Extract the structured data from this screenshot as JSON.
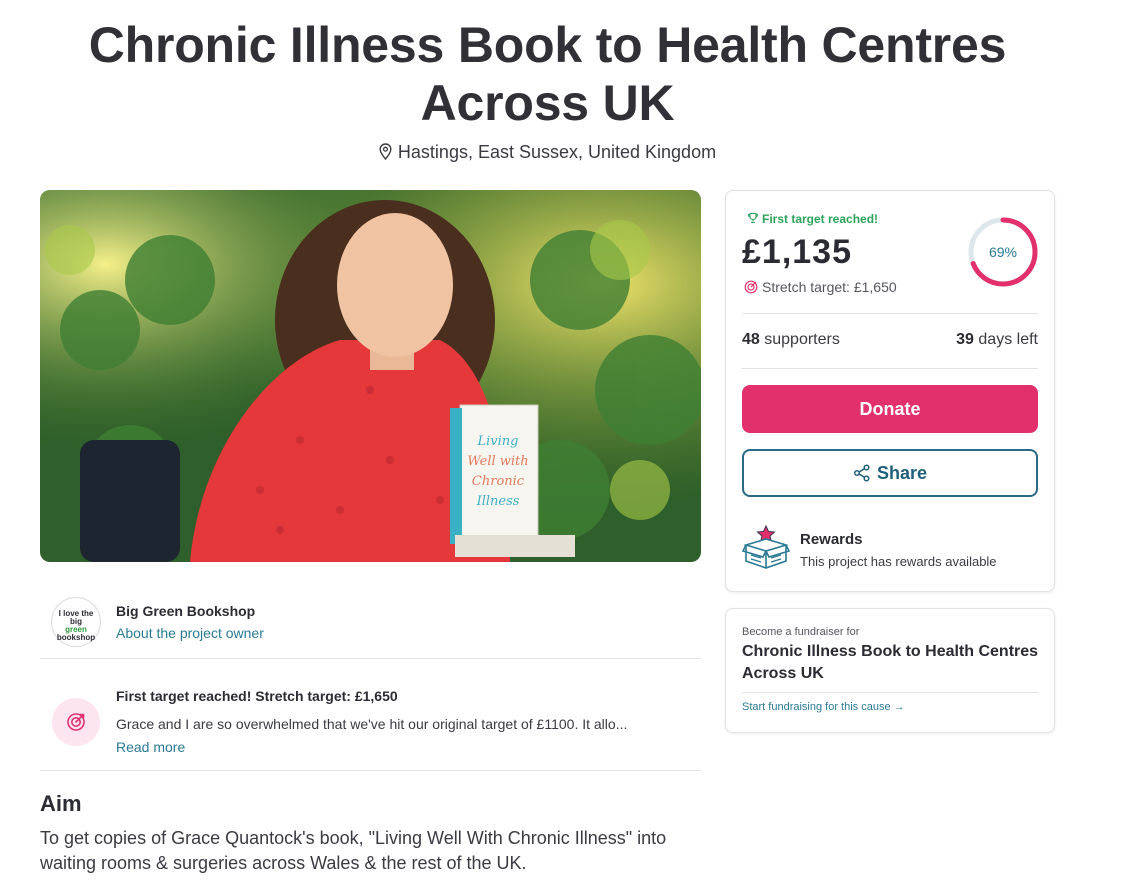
{
  "project": {
    "title": "Chronic Illness Book to Health Centres Across UK",
    "location": "Hastings, East Sussex, United Kingdom",
    "hero_image_alt": "photo"
  },
  "owner": {
    "name": "Big Green Bookshop",
    "link": "About the project owner",
    "logo_text_top": "I love the",
    "logo_text_mid": "big",
    "logo_text_green": "green",
    "logo_text_bottom": "bookshop"
  },
  "update": {
    "title": "First target reached! Stretch target: £1,650",
    "text": "Grace and I are so overwhelmed that we've hit our original target of £1100. It allo...",
    "link": "Read more"
  },
  "aim": {
    "heading": "Aim",
    "text": "To get copies of Grace Quantock's book, \"Living Well With Chronic Illness\" into waiting rooms & surgeries across Wales & the rest of the UK."
  },
  "funding": {
    "badge": "First target reached!",
    "amount": "£1,135",
    "stretch": "Stretch target: £1,650",
    "percent_label": "69%",
    "percent": 0.69,
    "supporters_count": "48",
    "supporters_label": "supporters",
    "days_count": "39",
    "days_label": "days left",
    "donate_label": "Donate",
    "share_label": "Share",
    "rewards_title": "Rewards",
    "rewards_text": "This project has rewards available"
  },
  "fundraiser": {
    "small": "Become a fundraiser for",
    "title": "Chronic Illness Book to Health Centres Across UK",
    "link": "Start fundraising for this cause →"
  },
  "colors": {
    "accent": "#e1306c",
    "link": "#2a7a93",
    "success": "#2ca35a",
    "share_border": "#2a6a85"
  }
}
